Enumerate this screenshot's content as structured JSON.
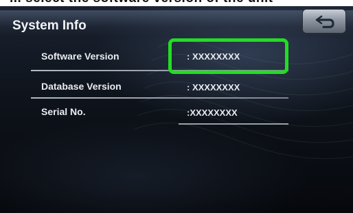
{
  "top_strip_text": "... select the software version of the unit",
  "header": {
    "title": "System Info",
    "back_icon": "return-arrow-icon"
  },
  "rows": [
    {
      "label": "Software Version",
      "value": ": XXXXXXXX"
    },
    {
      "label": "Database Version",
      "value": ": XXXXXXXX"
    },
    {
      "label": "Serial No.",
      "value": ":XXXXXXXX"
    }
  ],
  "colors": {
    "highlight": "#22dd22",
    "text": "#e9ecf0"
  }
}
